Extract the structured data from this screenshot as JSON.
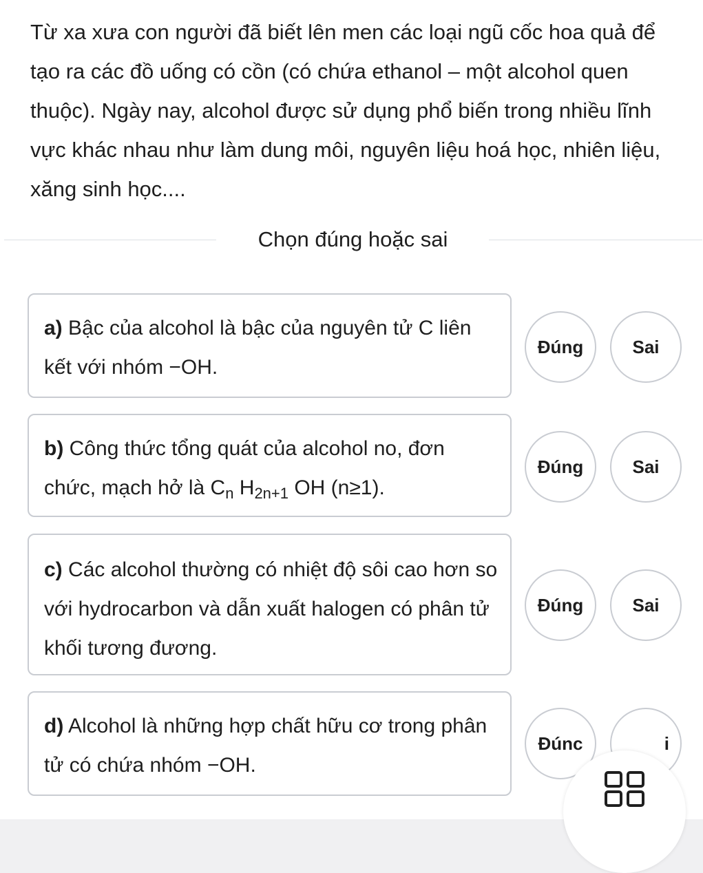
{
  "intro_text": "Từ xa xưa con người đã biết lên men các loại ngũ cốc hoa quả để tạo ra các đồ uống có cồn (có chứa ethanol – một alcohol quen thuộc). Ngày nay, alcohol được sử dụng phổ biến trong nhiều lĩnh vực khác nhau như làm dung môi, nguyên liệu hoá học, nhiên liệu, xăng sinh học....",
  "section_title": "Chọn đúng hoặc sai",
  "questions": [
    {
      "prefix": "a)",
      "text": " Bậc của alcohol là bậc của nguyên tử C liên kết với nhóm −OH.",
      "true_label": "Đúng",
      "false_label": "Sai"
    },
    {
      "prefix": "b)",
      "text_before": " Công thức tổng quát của alcohol no, đơn chức, mạch hở là C",
      "sub1": "n",
      "mid": " H",
      "sub2": "2n+1",
      "text_after": " OH (n≥1).",
      "true_label": "Đúng",
      "false_label": "Sai"
    },
    {
      "prefix": "c)",
      "text": " Các alcohol thường có nhiệt độ sôi cao hơn so với hydrocarbon và dẫn xuất halogen có phân tử khối tương đương.",
      "true_label": "Đúng",
      "false_label": "Sai"
    },
    {
      "prefix": "d)",
      "text": " Alcohol là những hợp chất hữu cơ trong phân tử có chứa nhóm −OH.",
      "true_label": "Đúnc",
      "false_label": "i"
    }
  ],
  "floating_button_icon": "grid-icon"
}
